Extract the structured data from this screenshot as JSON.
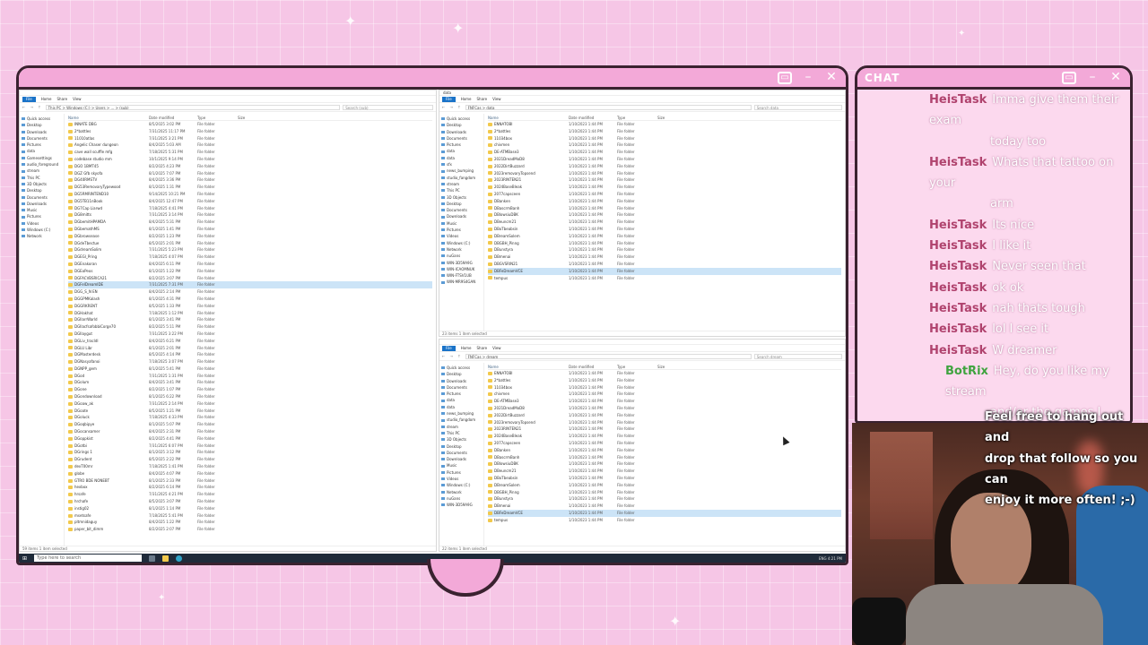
{
  "stream": {
    "chat_title": "CHAT",
    "chat_messages": [
      {
        "user": "HeisTask",
        "lines": [
          "Imma give them their exam",
          "today too"
        ]
      },
      {
        "user": "HeisTask",
        "lines": [
          "Whats that tattoo on your",
          "arm"
        ]
      },
      {
        "user": "HeisTask",
        "lines": [
          "Its nice"
        ]
      },
      {
        "user": "HeisTask",
        "lines": [
          "I like it"
        ]
      },
      {
        "user": "HeisTask",
        "lines": [
          "Never seen that"
        ]
      },
      {
        "user": "HeisTask",
        "lines": [
          "ok ok"
        ]
      },
      {
        "user": "HeisTask",
        "lines": [
          "nah thats tough"
        ]
      },
      {
        "user": "HeisTask",
        "lines": [
          "lol I see it"
        ]
      },
      {
        "user": "HeisTask",
        "lines": [
          "W dreamer"
        ]
      },
      {
        "user": "BotRix",
        "lines": [
          "Hey, do you like my stream",
          "and/or the games I stream?",
          "Or do you just like my chat?"
        ]
      }
    ],
    "chat_overflow": [
      "Feel free to hang out and",
      "drop that follow so you can",
      "enjoy it more often! ;-)"
    ],
    "colors": {
      "frame": "#3a2230",
      "accent": "#f3a9d8",
      "chat_user": "#b0436e",
      "bot_user": "#3fa33f"
    }
  },
  "explorer_left": {
    "path": "This PC  >  Windows (C:)  >  Users  >  ...  >  (sub)",
    "search_placeholder": "Search (sub)",
    "ribbon": [
      "File",
      "Home",
      "Share",
      "View"
    ],
    "columns": [
      "Name",
      "Date modified",
      "Type",
      "Size"
    ],
    "nav": [
      "Quick access",
      "Desktop",
      "Downloads",
      "Documents",
      "Pictures",
      "data",
      "Gamesettings",
      "audio_foreground",
      "stream",
      "This PC",
      "3D Objects",
      "Desktop",
      "Documents",
      "Downloads",
      "Music",
      "Pictures",
      "Videos",
      "Windows (C:)",
      "Network"
    ],
    "files": [
      {
        "name": "INNATE DBG",
        "date": "8/5/2025 3:02 PM",
        "type": "File folder"
      },
      {
        "name": "2*battles",
        "date": "7/31/2025 11:17 PM",
        "type": "File folder"
      },
      {
        "name": "11010atlas",
        "date": "7/31/2025 3:21 PM",
        "type": "File folder"
      },
      {
        "name": "Angelic Chaser dungeon",
        "date": "8/4/2025 5:03 AM",
        "type": "File folder"
      },
      {
        "name": "cave wall scuffle mfg",
        "date": "7/18/2025 5:31 PM",
        "type": "File folder"
      },
      {
        "name": "codebase studio mm",
        "date": "10/1/2025 9:14 PM",
        "type": "File folder"
      },
      {
        "name": "DGO 1BMT45",
        "date": "8/2/2025 4:23 PM",
        "type": "File folder"
      },
      {
        "name": "DGZ Gfb skyofa",
        "date": "8/1/2025 7:07 PM",
        "type": "File folder"
      },
      {
        "name": "DG40RMSTV",
        "date": "8/4/2025 3:36 PM",
        "type": "File folder"
      },
      {
        "name": "DG53RemovaryTypewood",
        "date": "8/1/2025 1:31 PM",
        "type": "File folder"
      },
      {
        "name": "DG5RMRINTEND10",
        "date": "9/14/2025 10:21 PM",
        "type": "File folder"
      },
      {
        "name": "DG5TB11nBook",
        "date": "8/4/2025 12:47 PM",
        "type": "File folder"
      },
      {
        "name": "DG7Cap Liarwd",
        "date": "7/18/2025 4:41 PM",
        "type": "File folder"
      },
      {
        "name": "DG8mitts",
        "date": "7/31/2025 3:14 PM",
        "type": "File folder"
      },
      {
        "name": "DGbemitHPAMDA",
        "date": "8/4/2025 5:31 PM",
        "type": "File folder"
      },
      {
        "name": "DGbemathMS",
        "date": "8/1/2025 1:41 PM",
        "type": "File folder"
      },
      {
        "name": "DGbrowsease",
        "date": "8/2/2025 1:23 PM",
        "type": "File folder"
      },
      {
        "name": "DGdeTbectue",
        "date": "8/5/2025 2:01 PM",
        "type": "File folder"
      },
      {
        "name": "DGdreamSolim",
        "date": "7/31/2025 5:23 PM",
        "type": "File folder"
      },
      {
        "name": "DGEGl_Pring",
        "date": "7/18/2025 4:07 PM",
        "type": "File folder"
      },
      {
        "name": "DGEnakoran",
        "date": "8/4/2025 6:11 PM",
        "type": "File folder"
      },
      {
        "name": "DGEoPeos",
        "date": "8/1/2025 1:22 PM",
        "type": "File folder"
      },
      {
        "name": "DGFACVBSRICA21",
        "date": "8/2/2025 3:07 PM",
        "type": "File folder"
      },
      {
        "name": "DGFelDreamIDE",
        "date": "7/31/2025 7:31 PM",
        "type": "File folder",
        "selected": true
      },
      {
        "name": "DGG_S_N EN",
        "date": "8/4/2025 2:14 PM",
        "type": "File folder"
      },
      {
        "name": "DGGPMKalash",
        "date": "8/1/2025 4:31 PM",
        "type": "File folder"
      },
      {
        "name": "DGGRKRENT",
        "date": "8/5/2025 1:33 PM",
        "type": "File folder"
      },
      {
        "name": "DGHakhat",
        "date": "7/18/2025 1:12 PM",
        "type": "File folder"
      },
      {
        "name": "DGIlarrWarld",
        "date": "8/1/2025 3:41 PM",
        "type": "File folder"
      },
      {
        "name": "DGIlacfsafobbiCorge70",
        "date": "8/2/2025 5:11 PM",
        "type": "File folder"
      },
      {
        "name": "DGIlaygut",
        "date": "7/31/2025 3:22 PM",
        "type": "File folder"
      },
      {
        "name": "DGLiv_tracldl",
        "date": "8/4/2025 6:21 PM",
        "type": "File folder"
      },
      {
        "name": "DGLU Libr",
        "date": "8/1/2025 2:01 PM",
        "type": "File folder"
      },
      {
        "name": "DGMasterdesk",
        "date": "8/5/2025 4:14 PM",
        "type": "File folder"
      },
      {
        "name": "DGNasyafanoi",
        "date": "7/18/2025 3:07 PM",
        "type": "File folder"
      },
      {
        "name": "DGNPP_gem",
        "date": "8/1/2025 5:41 PM",
        "type": "File folder"
      },
      {
        "name": "DGod",
        "date": "7/31/2025 1:31 PM",
        "type": "File folder"
      },
      {
        "name": "DGolum",
        "date": "8/4/2025 3:41 PM",
        "type": "File folder"
      },
      {
        "name": "DGone",
        "date": "8/2/2025 1:07 PM",
        "type": "File folder"
      },
      {
        "name": "DGondownload",
        "date": "8/1/2025 6:22 PM",
        "type": "File folder"
      },
      {
        "name": "DGoaw_ak",
        "date": "7/31/2025 2:14 PM",
        "type": "File folder"
      },
      {
        "name": "DGoate",
        "date": "8/5/2025 1:21 PM",
        "type": "File folder"
      },
      {
        "name": "DGoluck",
        "date": "7/18/2025 4:33 PM",
        "type": "File folder"
      },
      {
        "name": "DGoqbipye",
        "date": "8/1/2025 5:07 PM",
        "type": "File folder"
      },
      {
        "name": "DGocansamer",
        "date": "8/4/2025 2:31 PM",
        "type": "File folder"
      },
      {
        "name": "DGoppkist",
        "date": "8/2/2025 4:41 PM",
        "type": "File folder"
      },
      {
        "name": "DGotbi",
        "date": "7/31/2025 6:07 PM",
        "type": "File folder"
      },
      {
        "name": "DGrings 1",
        "date": "8/1/2025 3:12 PM",
        "type": "File folder"
      },
      {
        "name": "DGrudent",
        "date": "8/5/2025 2:22 PM",
        "type": "File folder"
      },
      {
        "name": "dexT00mr",
        "date": "7/18/2025 1:41 PM",
        "type": "File folder"
      },
      {
        "name": "globe",
        "date": "8/4/2025 4:07 PM",
        "type": "File folder"
      },
      {
        "name": "GTRO BDE NONEBT",
        "date": "8/1/2025 2:33 PM",
        "type": "File folder"
      },
      {
        "name": "hexbox",
        "date": "8/2/2025 6:14 PM",
        "type": "File folder"
      },
      {
        "name": "hrsafe",
        "date": "7/31/2025 4:21 PM",
        "type": "File folder"
      },
      {
        "name": "hrchafe",
        "date": "8/5/2025 3:07 PM",
        "type": "File folder"
      },
      {
        "name": "instig02",
        "date": "8/1/2025 1:14 PM",
        "type": "File folder"
      },
      {
        "name": "msetsafe",
        "date": "7/18/2025 5:41 PM",
        "type": "File folder"
      },
      {
        "name": "pltmnidaguy",
        "date": "8/4/2025 1:22 PM",
        "type": "File folder"
      },
      {
        "name": "paper_bit_dimm",
        "date": "8/2/2025 2:07 PM",
        "type": "File folder"
      }
    ],
    "status": "59 items   1 item selected"
  },
  "explorer_tr": {
    "title": "data",
    "path": "FNFCas  >  data",
    "search_placeholder": "Search data",
    "ribbon": [
      "File",
      "Home",
      "Share",
      "View"
    ],
    "columns": [
      "Name",
      "Date modified",
      "Type",
      "Size"
    ],
    "nav": [
      "Quick access",
      "Desktop",
      "Downloads",
      "Documents",
      "Pictures",
      "data",
      "data",
      "sfx",
      "news_bumping",
      "studio_fangdom",
      "stream",
      "This PC",
      "3D Objects",
      "Desktop",
      "Documents",
      "Downloads",
      "Music",
      "Pictures",
      "Videos",
      "Windows (C:)",
      "Network",
      "nuGans",
      "WIN-3D59A9G",
      "WIN-ICAOMNUK",
      "WIN-FTSV1UB",
      "WIN-MR9S4GAN"
    ],
    "files": [
      {
        "name": "ENNATOBI",
        "date": "1/10/2023 1:44 PM",
        "type": "File folder"
      },
      {
        "name": "2*battles",
        "date": "1/10/2023 1:44 PM",
        "type": "File folder"
      },
      {
        "name": "11034box",
        "date": "1/10/2023 1:44 PM",
        "type": "File folder"
      },
      {
        "name": "chivmen",
        "date": "1/10/2023 1:44 PM",
        "type": "File folder"
      },
      {
        "name": "DE-ATMBase3",
        "date": "1/10/2023 1:44 PM",
        "type": "File folder"
      },
      {
        "name": "2021DreadMoD8",
        "date": "1/10/2023 1:44 PM",
        "type": "File folder"
      },
      {
        "name": "2022DirtBuzzard",
        "date": "1/10/2023 1:44 PM",
        "type": "File folder"
      },
      {
        "name": "2023removaryTopsend",
        "date": "1/10/2023 1:44 PM",
        "type": "File folder"
      },
      {
        "name": "2023RINTEN21",
        "date": "1/10/2023 1:44 PM",
        "type": "File folder"
      },
      {
        "name": "2024BaseBleak",
        "date": "1/10/2023 1:44 PM",
        "type": "File folder"
      },
      {
        "name": "2077capsceen",
        "date": "1/10/2023 1:44 PM",
        "type": "File folder"
      },
      {
        "name": "DBanken",
        "date": "1/10/2023 1:44 PM",
        "type": "File folder"
      },
      {
        "name": "DBascrmBanh",
        "date": "1/10/2023 1:44 PM",
        "type": "File folder"
      },
      {
        "name": "DBlowsiuDBK",
        "date": "1/10/2023 1:44 PM",
        "type": "File folder"
      },
      {
        "name": "DBeuncm21",
        "date": "1/10/2023 1:44 PM",
        "type": "File folder"
      },
      {
        "name": "DBoTbeabsin",
        "date": "1/10/2023 1:44 PM",
        "type": "File folder"
      },
      {
        "name": "DBreamSolem",
        "date": "1/10/2023 1:44 PM",
        "type": "File folder"
      },
      {
        "name": "DBGBH_Pinng",
        "date": "1/10/2023 1:44 PM",
        "type": "File folder"
      },
      {
        "name": "DBunstyra",
        "date": "1/10/2023 1:44 PM",
        "type": "File folder"
      },
      {
        "name": "DBmenai",
        "date": "1/10/2023 1:44 PM",
        "type": "File folder"
      },
      {
        "name": "DBGVSRIN21",
        "date": "1/10/2023 1:44 PM",
        "type": "File folder"
      },
      {
        "name": "DBFeDreamVCE",
        "date": "1/10/2023 1:44 PM",
        "type": "File folder",
        "selected": true
      },
      {
        "name": "tempus",
        "date": "1/10/2023 1:44 PM",
        "type": "File folder"
      }
    ],
    "status": "23 items   1 item selected"
  },
  "explorer_br": {
    "path": "FNFCas  >  dream",
    "search_placeholder": "Search dream",
    "ribbon": [
      "File",
      "Home",
      "Share",
      "View"
    ],
    "columns": [
      "Name",
      "Date modified",
      "Type",
      "Size"
    ],
    "nav": [
      "Quick access",
      "Desktop",
      "Downloads",
      "Documents",
      "Pictures",
      "data",
      "data",
      "news_bumping",
      "studio_fangdom",
      "dream",
      "This PC",
      "3D Objects",
      "Desktop",
      "Documents",
      "Downloads",
      "Music",
      "Pictures",
      "Videos",
      "Windows (C:)",
      "Network",
      "nuGans",
      "WIN-3D59A9G"
    ],
    "files": [
      {
        "name": "ENNATOBI",
        "date": "1/10/2023 1:44 PM",
        "type": "File folder"
      },
      {
        "name": "2*battles",
        "date": "1/10/2023 1:44 PM",
        "type": "File folder"
      },
      {
        "name": "11034box",
        "date": "1/10/2023 1:44 PM",
        "type": "File folder"
      },
      {
        "name": "chivmen",
        "date": "1/10/2023 1:44 PM",
        "type": "File folder"
      },
      {
        "name": "DE-ATMBase3",
        "date": "1/10/2023 1:44 PM",
        "type": "File folder"
      },
      {
        "name": "2021DreadMoD8",
        "date": "1/10/2023 1:44 PM",
        "type": "File folder"
      },
      {
        "name": "2022DirtBuzzard",
        "date": "1/10/2023 1:44 PM",
        "type": "File folder"
      },
      {
        "name": "2023removaryTopsend",
        "date": "1/10/2023 1:44 PM",
        "type": "File folder"
      },
      {
        "name": "2023RINTEN21",
        "date": "1/10/2023 1:44 PM",
        "type": "File folder"
      },
      {
        "name": "2024BaseBleak",
        "date": "1/10/2023 1:44 PM",
        "type": "File folder"
      },
      {
        "name": "2077capsceen",
        "date": "1/10/2023 1:44 PM",
        "type": "File folder"
      },
      {
        "name": "DBanken",
        "date": "1/10/2023 1:44 PM",
        "type": "File folder"
      },
      {
        "name": "DBascrmBanh",
        "date": "1/10/2023 1:44 PM",
        "type": "File folder"
      },
      {
        "name": "DBlowsiuDBK",
        "date": "1/10/2023 1:44 PM",
        "type": "File folder"
      },
      {
        "name": "DBeuncm21",
        "date": "1/10/2023 1:44 PM",
        "type": "File folder"
      },
      {
        "name": "DBoTbeabsin",
        "date": "1/10/2023 1:44 PM",
        "type": "File folder"
      },
      {
        "name": "DBreamSolem",
        "date": "1/10/2023 1:44 PM",
        "type": "File folder"
      },
      {
        "name": "DBGBH_Pinng",
        "date": "1/10/2023 1:44 PM",
        "type": "File folder"
      },
      {
        "name": "DBunstyra",
        "date": "1/10/2023 1:44 PM",
        "type": "File folder"
      },
      {
        "name": "DBmenai",
        "date": "1/10/2023 1:44 PM",
        "type": "File folder"
      },
      {
        "name": "DBFeDreamVCE",
        "date": "1/10/2023 1:44 PM",
        "type": "File folder",
        "selected": true
      },
      {
        "name": "tempus",
        "date": "1/10/2023 1:44 PM",
        "type": "File folder"
      }
    ],
    "status": "22 items   1 item selected"
  },
  "taskbar": {
    "search_placeholder": "Type here to search",
    "tray": "ENG  4:21 PM"
  }
}
